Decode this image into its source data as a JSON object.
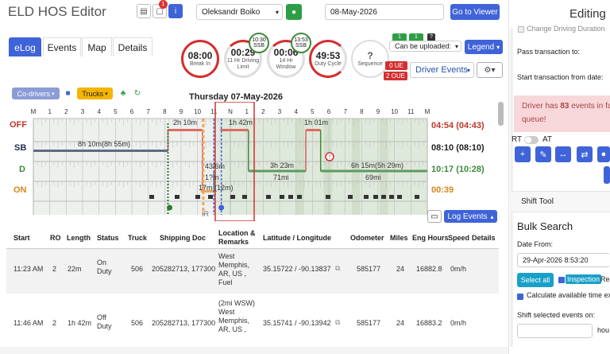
{
  "app": {
    "title": "ELD HOS Editor",
    "notification_count": "1"
  },
  "driver": {
    "name": "Oleksandr Boiko"
  },
  "date": {
    "value": "08-May-2026"
  },
  "buttons": {
    "go_to_viewer": "Go to Viewer",
    "legend": "Legend",
    "driver_events": "Driver Events",
    "log_events": "Log Events",
    "co_drivers": "Co-drivers",
    "trucks": "Trucks",
    "select_all": "Select all",
    "inspection": "Inspection"
  },
  "tabs": [
    {
      "label": "eLog"
    },
    {
      "label": "Events"
    },
    {
      "label": "Map"
    },
    {
      "label": "Details"
    }
  ],
  "gauges": {
    "break": {
      "value": "08:00",
      "label": "Break In"
    },
    "driving": {
      "value": "00:29",
      "label": "11 Hr Driving Limit"
    },
    "window": {
      "value": "00:06",
      "label": "14 Hr Window"
    },
    "cycle": {
      "value": "49:53",
      "label": "Duty Cycle"
    },
    "sequence": {
      "value": "?",
      "label": "Sequence"
    },
    "ssb1": {
      "value": "10:30",
      "label": "SSB"
    },
    "ssb2": {
      "value": "13:53",
      "label": "SSB"
    }
  },
  "status": {
    "can_upload": "Can be uploaded:",
    "ue0": "0 UE",
    "ue2": "2 OUE",
    "q1": "1",
    "q2": "1",
    "q3": "?"
  },
  "chart": {
    "day_title": "Thursday 07-May-2026",
    "hours": [
      "M",
      "1",
      "2",
      "3",
      "4",
      "5",
      "6",
      "7",
      "8",
      "9",
      "10",
      "11",
      "N",
      "1",
      "2",
      "3",
      "4",
      "5",
      "6",
      "7",
      "8",
      "9",
      "10",
      "11",
      "M"
    ],
    "rows": [
      {
        "label": "OFF",
        "total": "04:54 (04:43)",
        "color": "#c0392b"
      },
      {
        "label": "SB",
        "total": "08:10 (08:10)",
        "color": "#1f2d4d"
      },
      {
        "label": "D",
        "total": "10:17 (10:28)",
        "color": "#3a8a3a"
      },
      {
        "label": "ON",
        "total": "00:39",
        "color": "#d9851a"
      }
    ],
    "annotations": {
      "a1": "2h 10m",
      "a2": "1h 42m",
      "a3": "1h 01m",
      "a4": "8h 10m(8h 55m)",
      "a5": "3h 23m",
      "a6": "71mi",
      "a7": "6h 15m(5h 29m)",
      "a8": "69mi",
      "a9": "43/6m",
      "a10": "1?m",
      "a11": "17m (12m)",
      "a12": "IR"
    }
  },
  "table": {
    "headers": [
      "Start",
      "RO",
      "Length",
      "Status",
      "Truck",
      "Shipping Doc",
      "Location & Remarks",
      "Latitude / Longitude",
      "Odometer",
      "Miles",
      "Eng Hours",
      "Speed",
      "Details"
    ],
    "rows": [
      {
        "start": "11:23 AM",
        "ro": "2",
        "length": "22m",
        "status": "On Duty",
        "truck": "506",
        "doc": "205282713, 177300",
        "loc": "West Memphis, AR, US , Fuel",
        "latlon": "35.15722 / -90.13837",
        "odo": "585177",
        "miles": "24",
        "eng": "16882.8",
        "speed": "0m/h"
      },
      {
        "start": "11:46 AM",
        "ro": "2",
        "length": "1h 42m",
        "status": "Off Duty",
        "truck": "506",
        "doc": "205282713, 177300",
        "loc": "(2mi WSW) West Memphis, AR, US ,",
        "latlon": "35.15741 / -90.13942",
        "odo": "585177",
        "miles": "24",
        "eng": "16883.2",
        "speed": "0m/h"
      }
    ]
  },
  "right_panel": {
    "editing": "Editing",
    "change_duration": "Change Driving Duration",
    "pass_transaction": "Pass transaction to:",
    "start_transaction": "Start transaction from date:",
    "alert_prefix": "Driver has ",
    "alert_count": "83",
    "alert_suffix": " events in fa",
    "alert_line2": "queue!",
    "rt": "RT",
    "at": "AT",
    "shift_tool": "Shift Tool",
    "bulk_search": "Bulk Search",
    "date_from_label": "Date From:",
    "date_from_value": "29-Apr-2026 8:53:20",
    "re": "Re",
    "calc_available": "Calculate available time ex",
    "shift_selected": "Shift selected events on:",
    "hours_unit": "hou"
  }
}
